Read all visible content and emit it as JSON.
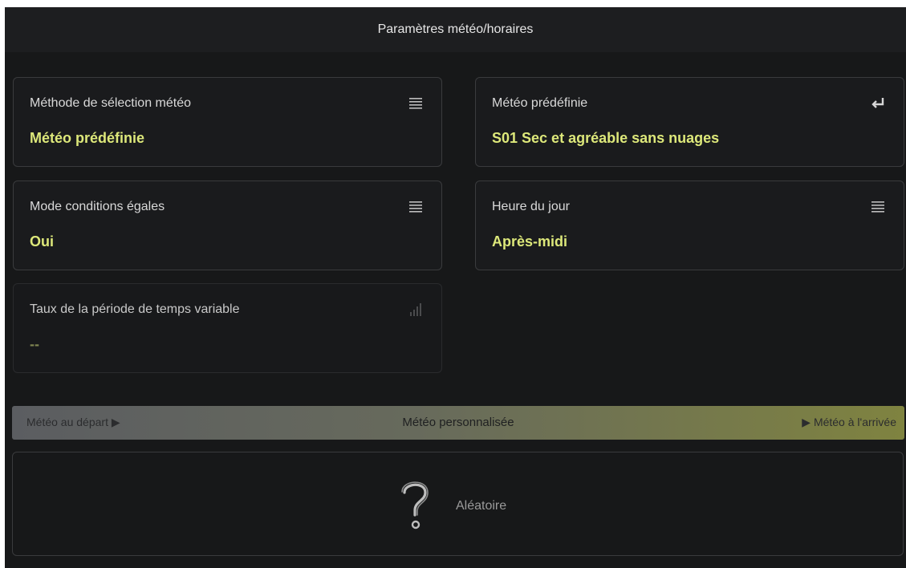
{
  "header": {
    "title": "Paramètres météo/horaires"
  },
  "cards": {
    "weather_method": {
      "label": "Méthode de sélection météo",
      "value": "Météo prédéfinie",
      "icon": "list-icon"
    },
    "preset_weather": {
      "label": "Météo prédéfinie",
      "value": "S01 Sec et agréable sans nuages",
      "icon": "return-arrow-icon"
    },
    "equal_conditions": {
      "label": "Mode conditions égales",
      "value": "Oui",
      "icon": "list-icon"
    },
    "time_of_day": {
      "label": "Heure du jour",
      "value": "Après-midi",
      "icon": "list-icon"
    },
    "variable_rate": {
      "label": "Taux de la période de temps variable",
      "value": "--",
      "icon": "signal-bars-icon"
    }
  },
  "timeline": {
    "left_label": "Météo au départ ▶",
    "center_label": "Météo personnalisée",
    "right_label": "▶ Météo à l'arrivée"
  },
  "random": {
    "label": "Aléatoire",
    "icon": "question-mark-icon"
  },
  "colors": {
    "accent": "#dde87a",
    "background": "#171819",
    "border": "#3a3b3d"
  }
}
